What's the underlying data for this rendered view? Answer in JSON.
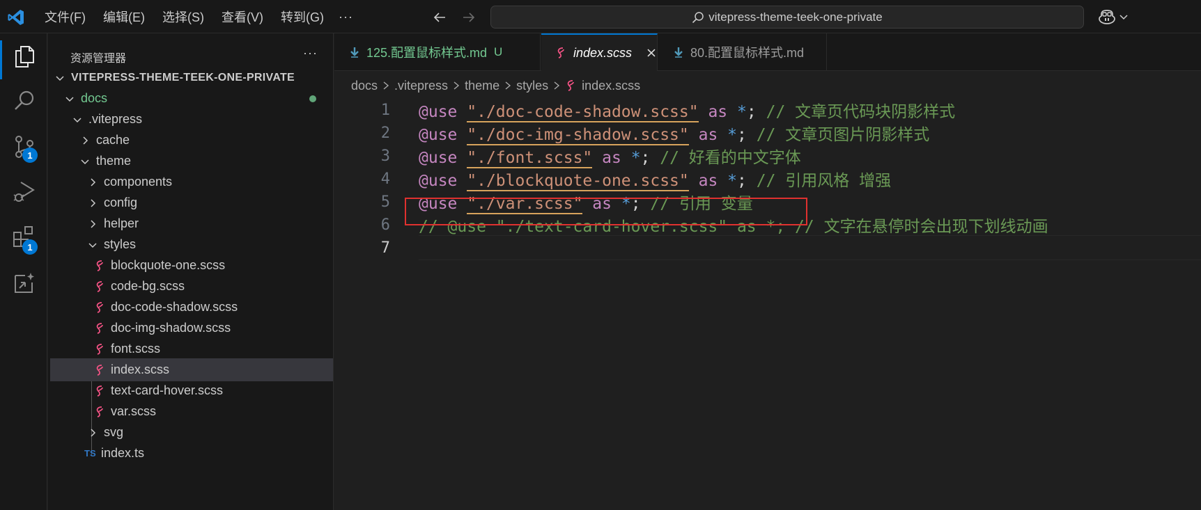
{
  "titlebar": {
    "menu": [
      "文件(F)",
      "编辑(E)",
      "选择(S)",
      "查看(V)",
      "转到(G)"
    ],
    "more": "···",
    "search_text": "vitepress-theme-teek-one-private"
  },
  "activity": {
    "scm_badge": "1",
    "extensions_badge": "1"
  },
  "explorer": {
    "title": "资源管理器",
    "more": "···",
    "tree": {
      "root": "VITEPRESS-THEME-TEEK-ONE-PRIVATE",
      "docs": "docs",
      "vitepress": ".vitepress",
      "cache": "cache",
      "theme": "theme",
      "components": "components",
      "config": "config",
      "helper": "helper",
      "styles": "styles",
      "f1": "blockquote-one.scss",
      "f2": "code-bg.scss",
      "f3": "doc-code-shadow.scss",
      "f4": "doc-img-shadow.scss",
      "f5": "font.scss",
      "f6": "index.scss",
      "f7": "text-card-hover.scss",
      "f8": "var.scss",
      "svg": "svg",
      "index_ts": "index.ts",
      "ts_badge": "TS"
    }
  },
  "tabs": [
    {
      "label": "125.配置鼠标样式.md",
      "status": "U"
    },
    {
      "label": "index.scss"
    },
    {
      "label": "80.配置鼠标样式.md"
    }
  ],
  "breadcrumb": [
    "docs",
    ".vitepress",
    "theme",
    "styles",
    "index.scss"
  ],
  "code": {
    "line_numbers": [
      "1",
      "2",
      "3",
      "4",
      "5",
      "6",
      "7"
    ],
    "lines": [
      {
        "kw": "@use",
        "str": "\"./doc-code-shadow.scss\"",
        "as": "as",
        "star": "*",
        "semi": ";",
        "comment": "// 文章页代码块阴影样式"
      },
      {
        "kw": "@use",
        "str": "\"./doc-img-shadow.scss\"",
        "as": "as",
        "star": "*",
        "semi": ";",
        "comment": "// 文章页图片阴影样式"
      },
      {
        "kw": "@use",
        "str": "\"./font.scss\"",
        "as": "as",
        "star": "*",
        "semi": ";",
        "comment": "// 好看的中文字体"
      },
      {
        "kw": "@use",
        "str": "\"./blockquote-one.scss\"",
        "as": "as",
        "star": "*",
        "semi": ";",
        "comment": "// 引用风格 增强"
      },
      {
        "kw": "@use",
        "str": "\"./var.scss\"",
        "as": "as",
        "star": "*",
        "semi": ";",
        "comment": "// 引用 变量"
      },
      {
        "comment": "// @use \"./text-card-hover.scss\" as *; // 文字在悬停时会出现下划线动画"
      }
    ]
  },
  "colors": {
    "accent": "#0078d4",
    "keyword": "#c586c0",
    "string": "#ce9178",
    "comment": "#6a9955",
    "highlight_box": "#e0312f"
  }
}
